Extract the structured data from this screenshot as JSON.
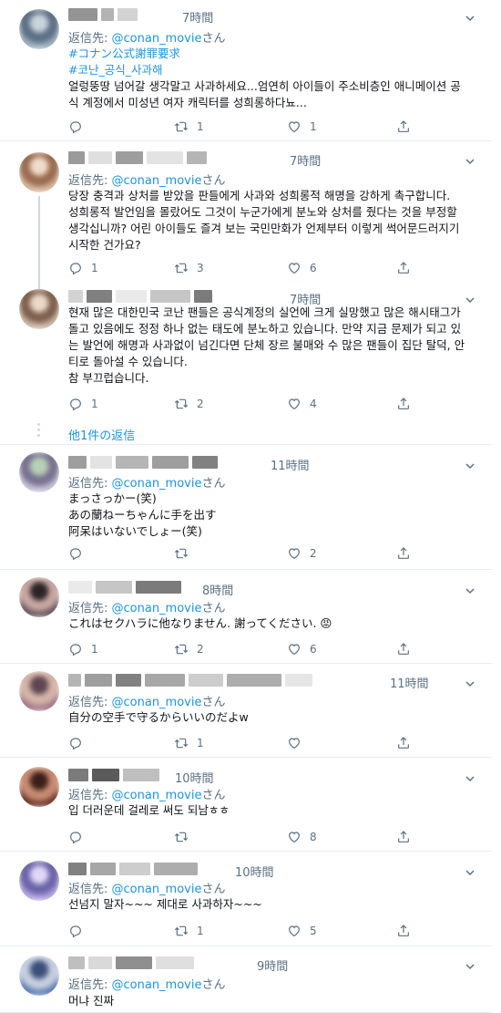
{
  "reply_prefix": "返信先: ",
  "reply_suffix": "さん",
  "more_replies_label": "他1件の返信",
  "colors": {
    "link": "#1b95e0",
    "muted": "#5b7083",
    "text": "#0f1419",
    "divider": "#e6ecf0"
  },
  "tweets": [
    {
      "time": "7時間",
      "handle": "@conan_movie",
      "lines": [
        {
          "text": "#コナン公式謝罪要求",
          "tag": true
        },
        {
          "text": "#코난_공식_사과해",
          "tag": true
        },
        {
          "text": "얼렁뚱땅 넘어갈 생각말고 사과하세요...엄연히 아이들이 주소비층인 애니메이션 공"
        },
        {
          "text": "식 계정에서 미성년 여자 캐릭터를 성희롱하다뇨..."
        }
      ],
      "reply_count": "",
      "retweet_count": "1",
      "like_count": "1"
    },
    {
      "time": "7時間",
      "handle": "@conan_movie",
      "lines": [
        {
          "text": "당장 충격과 상처를 받았을 판들에게 사과와 성희롱적 해명을 강하게 촉구합니다."
        },
        {
          "text": "성희롱적 발언임을 몰랐어도 그것이 누군가에게 분노와 상처를 줬다는 것을 부정할"
        },
        {
          "text": "생각십니까? 어린 아이들도 즐겨 보는 국민만화가 언제부터 이렇게 썩어문드러지기"
        },
        {
          "text": "시작한 건가요?"
        }
      ],
      "reply_count": "1",
      "retweet_count": "3",
      "like_count": "6"
    },
    {
      "time": "7時間",
      "handle": "",
      "lines": [
        {
          "text": "현재 많은 대한민국 코난 팬들은 공식계정의 실언에 크게 실망했고 많은 해시태그가"
        },
        {
          "text": "돌고 있음에도 정정 하나 없는 태도에 분노하고 있습니다. 만약 지금 문제가 되고 있"
        },
        {
          "text": "는 발언에 해명과 사과없이 넘긴다면 단체 장르 불매와 수 많은 팬들이 집단 탈덕, 안"
        },
        {
          "text": "티로 돌아설 수 있습니다."
        },
        {
          "text": "참 부끄럽습니다."
        }
      ],
      "reply_count": "1",
      "retweet_count": "2",
      "like_count": "4"
    },
    {
      "time": "11時間",
      "handle": "@conan_movie",
      "lines": [
        {
          "text": "まっさっかー(笑)"
        },
        {
          "text": "あの蘭ねーちゃんに手を出す"
        },
        {
          "text": "阿呆はいないでしょー(笑)"
        }
      ],
      "reply_count": "",
      "retweet_count": "",
      "like_count": "2"
    },
    {
      "time": "8時間",
      "handle": "@conan_movie",
      "lines": [
        {
          "text": "これはセクハラに他なりません. 謝ってください. 😡"
        }
      ],
      "reply_count": "1",
      "retweet_count": "2",
      "like_count": "6"
    },
    {
      "time": "11時間",
      "handle": "@conan_movie",
      "lines": [
        {
          "text": "自分の空手で守るからいいのだよw"
        }
      ],
      "reply_count": "",
      "retweet_count": "1",
      "like_count": ""
    },
    {
      "time": "10時間",
      "handle": "@conan_movie",
      "lines": [
        {
          "text": "입 더러운데 걸레로 써도 되남ㅎㅎ"
        }
      ],
      "reply_count": "",
      "retweet_count": "",
      "like_count": "8"
    },
    {
      "time": "10時間",
      "handle": "@conan_movie",
      "lines": [
        {
          "text": "선넘지 말자~~~ 제대로 사과하자~~~"
        }
      ],
      "reply_count": "",
      "retweet_count": "1",
      "like_count": "5"
    },
    {
      "time": "9時間",
      "handle": "@conan_movie",
      "lines": [
        {
          "text": "머냐 진짜"
        }
      ],
      "reply_count": "",
      "retweet_count": "",
      "like_count": ""
    }
  ]
}
